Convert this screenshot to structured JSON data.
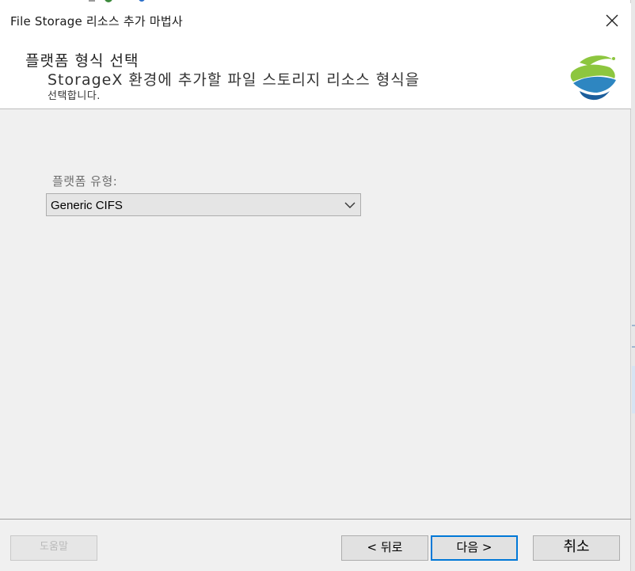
{
  "window": {
    "title": "File Storage 리소스 추가 마법사"
  },
  "header": {
    "title": "플랫폼 형식 선택",
    "subtitle_line1": "StorageX 환경에 추가할 파일 스토리지 리소스 형식을",
    "subtitle_line2": "선택합니다."
  },
  "form": {
    "platform_label": "플랫폼 유형:",
    "platform_value": "Generic CIFS"
  },
  "footer": {
    "help_label": "도움말",
    "back_label": "< 뒤로",
    "next_label": "다음 >",
    "cancel_label": "취소"
  },
  "icons": {
    "close": "close-icon",
    "logo": "storagex-logo",
    "dropdown": "chevron-down-icon"
  },
  "colors": {
    "accent": "#0078d7",
    "logo_green": "#8dc63f",
    "logo_blue": "#1b75bb"
  }
}
